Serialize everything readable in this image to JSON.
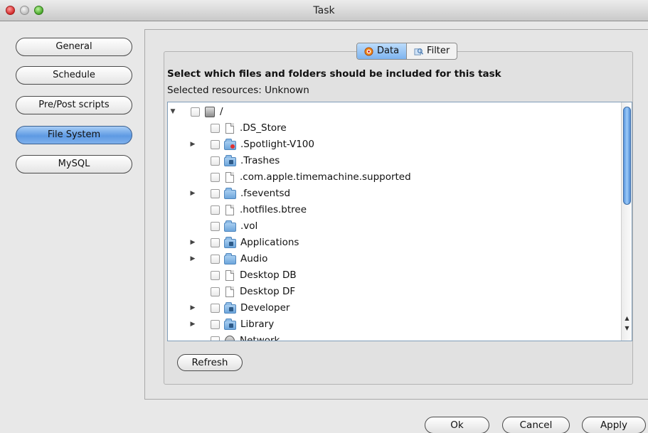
{
  "window": {
    "title": "Task"
  },
  "nav": [
    {
      "label": "General",
      "active": false
    },
    {
      "label": "Schedule",
      "active": false
    },
    {
      "label": "Pre/Post scripts",
      "active": false
    },
    {
      "label": "File System",
      "active": true
    },
    {
      "label": "MySQL",
      "active": false
    }
  ],
  "tabs": [
    {
      "label": "Data",
      "active": true,
      "icon": "data-icon"
    },
    {
      "label": "Filter",
      "active": false,
      "icon": "filter-icon"
    }
  ],
  "heading": "Select which files and folders should be included for this task",
  "selected_resources": "Selected resources: Unknown",
  "tree": [
    {
      "label": "/",
      "icon": "drive-icon",
      "expander": "expanded",
      "level": 0
    },
    {
      "label": ".DS_Store",
      "icon": "document-icon",
      "expander": "none",
      "level": 1
    },
    {
      "label": ".Spotlight-V100",
      "icon": "spotlight-folder-icon",
      "expander": "collapsed",
      "level": 1
    },
    {
      "label": ".Trashes",
      "icon": "trash-folder-icon",
      "expander": "none",
      "level": 1
    },
    {
      "label": ".com.apple.timemachine.supported",
      "icon": "document-icon",
      "expander": "none",
      "level": 1
    },
    {
      "label": ".fseventsd",
      "icon": "folder-icon",
      "expander": "collapsed",
      "level": 1
    },
    {
      "label": ".hotfiles.btree",
      "icon": "document-icon",
      "expander": "none",
      "level": 1
    },
    {
      "label": ".vol",
      "icon": "folder-icon",
      "expander": "none",
      "level": 1
    },
    {
      "label": "Applications",
      "icon": "applications-folder-icon",
      "expander": "collapsed",
      "level": 1
    },
    {
      "label": "Audio",
      "icon": "folder-icon",
      "expander": "collapsed",
      "level": 1
    },
    {
      "label": "Desktop DB",
      "icon": "document-icon",
      "expander": "none",
      "level": 1
    },
    {
      "label": "Desktop DF",
      "icon": "document-icon",
      "expander": "none",
      "level": 1
    },
    {
      "label": "Developer",
      "icon": "developer-folder-icon",
      "expander": "collapsed",
      "level": 1
    },
    {
      "label": "Library",
      "icon": "library-folder-icon",
      "expander": "collapsed",
      "level": 1
    },
    {
      "label": "Network",
      "icon": "network-icon",
      "expander": "none",
      "level": 1
    }
  ],
  "buttons": {
    "refresh": "Refresh",
    "ok": "Ok",
    "cancel": "Cancel",
    "apply": "Apply"
  }
}
